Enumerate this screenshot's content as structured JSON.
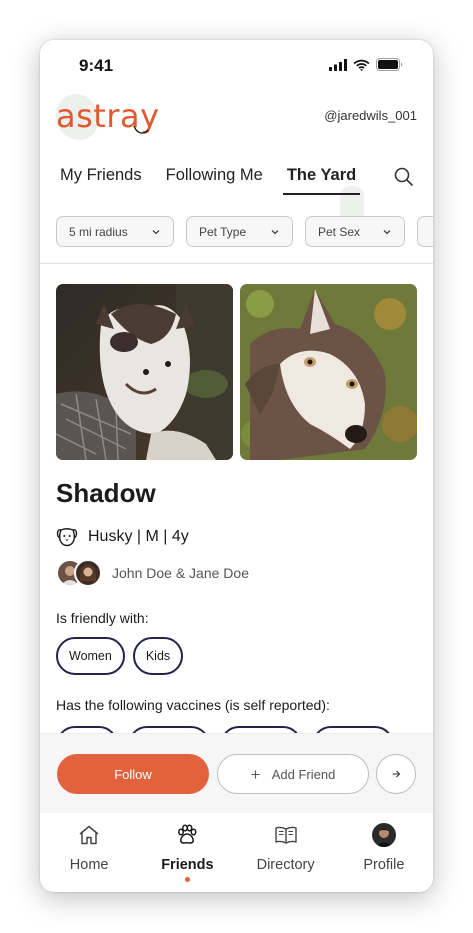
{
  "status_bar": {
    "time": "9:41"
  },
  "header": {
    "logo_text": "astray",
    "username": "@jaredwils_001"
  },
  "tabs": [
    {
      "label": "My Friends",
      "active": false
    },
    {
      "label": "Following Me",
      "active": false
    },
    {
      "label": "The Yard",
      "active": true
    }
  ],
  "filters": [
    {
      "label": "5 mi radius"
    },
    {
      "label": "Pet Type"
    },
    {
      "label": "Pet Sex"
    },
    {
      "label": ""
    }
  ],
  "pet": {
    "name": "Shadow",
    "breed_info": "Husky | M | 4y",
    "owners": "John Doe & Jane Doe",
    "friendly_label": "Is friendly with:",
    "friendly_with": [
      "Women",
      "Kids"
    ],
    "vaccines_label": "Has the following vaccines (is self reported):"
  },
  "actions": {
    "follow_label": "Follow",
    "add_friend_label": "Add Friend"
  },
  "nav": [
    {
      "label": "Home",
      "icon": "home-icon",
      "active": false
    },
    {
      "label": "Friends",
      "icon": "paw-icon",
      "active": true
    },
    {
      "label": "Directory",
      "icon": "book-icon",
      "active": false
    },
    {
      "label": "Profile",
      "icon": "avatar",
      "active": false
    }
  ],
  "colors": {
    "brand": "#e05a2f",
    "follow_button": "#e1623c",
    "pill_border": "#23234a",
    "active_dot": "#e1623c"
  }
}
